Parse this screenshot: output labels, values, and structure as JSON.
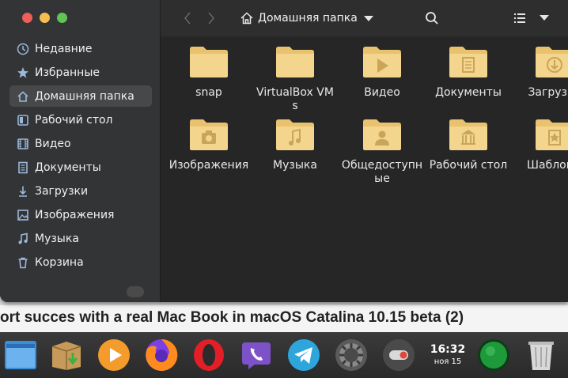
{
  "window": {
    "sidebar": {
      "items": [
        {
          "label": "Недавние",
          "icon": "clock-icon"
        },
        {
          "label": "Избранные",
          "icon": "star-icon"
        },
        {
          "label": "Домашняя папка",
          "icon": "home-icon",
          "active": true
        },
        {
          "label": "Рабочий стол",
          "icon": "desktop-icon"
        },
        {
          "label": "Видео",
          "icon": "film-icon"
        },
        {
          "label": "Документы",
          "icon": "document-icon"
        },
        {
          "label": "Загрузки",
          "icon": "download-icon"
        },
        {
          "label": "Изображения",
          "icon": "image-icon"
        },
        {
          "label": "Музыка",
          "icon": "music-icon"
        },
        {
          "label": "Корзина",
          "icon": "trash-icon"
        }
      ]
    },
    "header": {
      "path_label": "Домашняя папка"
    },
    "files": [
      {
        "name": "snap",
        "emblem": "none"
      },
      {
        "name": "VirtualBox VMs",
        "emblem": "none"
      },
      {
        "name": "Видео",
        "emblem": "play"
      },
      {
        "name": "Документы",
        "emblem": "doc"
      },
      {
        "name": "Загрузки",
        "emblem": "download"
      },
      {
        "name": "Изображения",
        "emblem": "camera"
      },
      {
        "name": "Музыка",
        "emblem": "music"
      },
      {
        "name": "Общедоступные",
        "emblem": "person"
      },
      {
        "name": "Рабочий стол",
        "emblem": "building"
      },
      {
        "name": "Шаблоны",
        "emblem": "template"
      }
    ]
  },
  "background": {
    "headline": "ort succes with a real Mac Book in macOS Catalina 10.15 beta (2)"
  },
  "dock": {
    "clock_time": "16:32",
    "clock_date": "ноя 15"
  },
  "colors": {
    "folder": "#f4d58d",
    "folder_dark": "#e8c26f",
    "emblem": "#c9a55a",
    "sidebar_bg": "#333436",
    "content_bg": "#262626",
    "active_item": "#474849"
  }
}
